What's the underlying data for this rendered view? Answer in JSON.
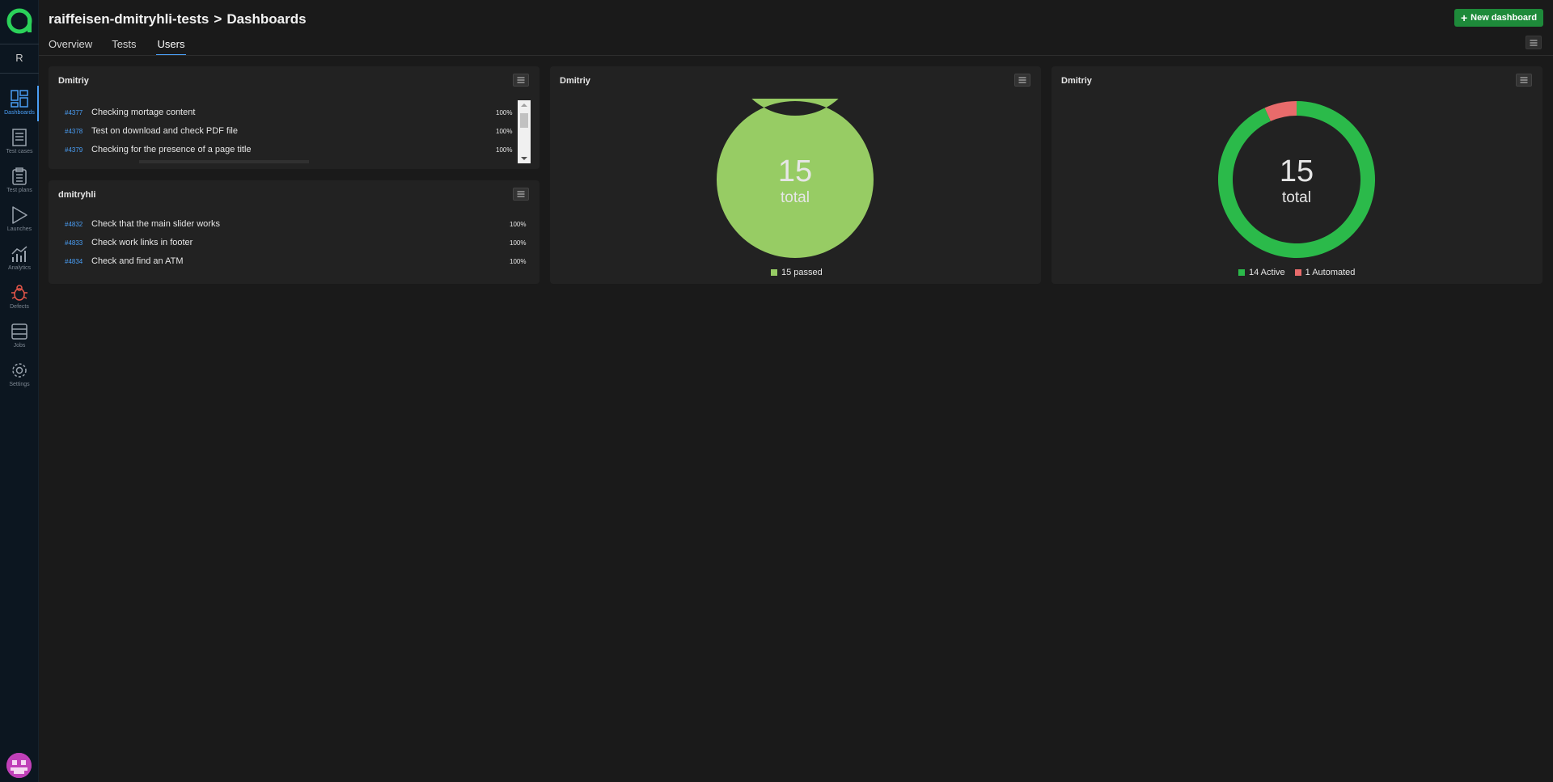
{
  "sidebar": {
    "project_letter": "R",
    "items": [
      {
        "label": "Dashboards",
        "icon": "dashboards-icon",
        "active": true
      },
      {
        "label": "Test cases",
        "icon": "test-cases-icon"
      },
      {
        "label": "Test plans",
        "icon": "test-plans-icon"
      },
      {
        "label": "Launches",
        "icon": "launches-icon"
      },
      {
        "label": "Analytics",
        "icon": "analytics-icon"
      },
      {
        "label": "Defects",
        "icon": "defects-icon"
      },
      {
        "label": "Jobs",
        "icon": "jobs-icon"
      },
      {
        "label": "Settings",
        "icon": "settings-icon"
      }
    ]
  },
  "header": {
    "project": "raiffeisen-dmitryhli-tests",
    "separator": ">",
    "section": "Dashboards",
    "new_dashboard_label": "New dashboard",
    "tabs": [
      {
        "label": "Overview"
      },
      {
        "label": "Tests"
      },
      {
        "label": "Users",
        "active": true
      }
    ]
  },
  "widgets": {
    "list1": {
      "title": "Dmitriy",
      "rows": [
        {
          "id": "#4377",
          "title": "Checking mortage content",
          "pct": "100%"
        },
        {
          "id": "#4378",
          "title": "Test on download and check PDF file",
          "pct": "100%"
        },
        {
          "id": "#4379",
          "title": "Checking for the presence of a page title",
          "pct": "100%"
        }
      ]
    },
    "list2": {
      "title": "dmitryhli",
      "rows": [
        {
          "id": "#4832",
          "title": "Check that the main slider works",
          "pct": "100%"
        },
        {
          "id": "#4833",
          "title": "Check work links in footer",
          "pct": "100%"
        },
        {
          "id": "#4834",
          "title": "Check and find an ATM",
          "pct": "100%"
        }
      ]
    },
    "donut1": {
      "title": "Dmitriy",
      "total": "15",
      "total_label": "total",
      "legend": [
        {
          "label": "15 passed",
          "color": "#97cc64",
          "value": 15
        }
      ]
    },
    "donut2": {
      "title": "Dmitriy",
      "total": "15",
      "total_label": "total",
      "legend": [
        {
          "label": "14 Active",
          "color": "#2bba4a",
          "value": 14
        },
        {
          "label": "1 Automated",
          "color": "#e86b6b",
          "value": 1
        }
      ]
    }
  },
  "colors": {
    "accent": "#4a9ef5",
    "button_green": "#1e8a3a",
    "passed": "#97cc64",
    "active": "#2bba4a",
    "automated": "#e86b6b"
  }
}
